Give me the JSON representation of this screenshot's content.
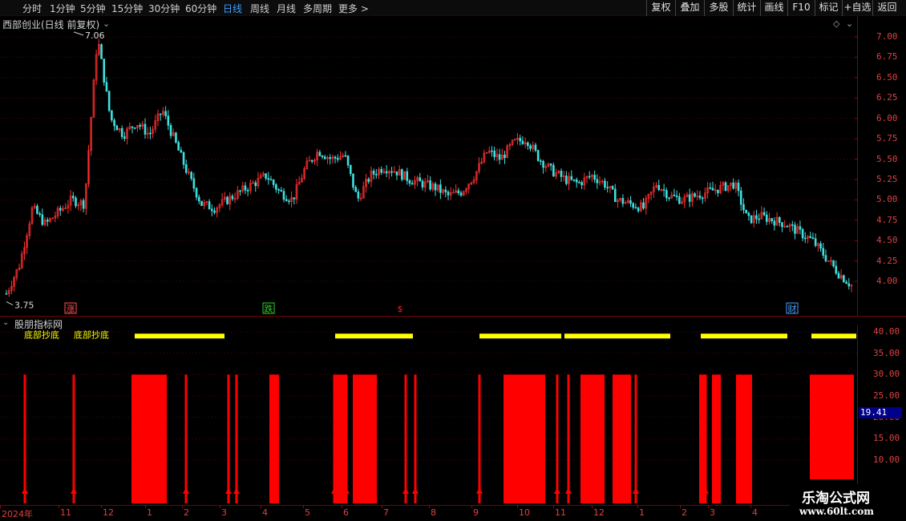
{
  "toolbar": {
    "periods": [
      "分时",
      "1分钟",
      "5分钟",
      "15分钟",
      "30分钟",
      "60分钟",
      "日线",
      "周线",
      "月线",
      "多周期",
      "更多 >"
    ],
    "active_period": "日线",
    "buttons": [
      "复权",
      "叠加",
      "多股",
      "统计",
      "画线",
      "F10",
      "标记",
      "+自选",
      "返回"
    ]
  },
  "main_chart": {
    "title": "西部创业(日线 前复权)",
    "price_axis": [
      "7.00",
      "6.75",
      "6.50",
      "6.25",
      "6.00",
      "5.75",
      "5.50",
      "5.25",
      "5.00",
      "4.75",
      "4.50",
      "4.25",
      "4.00"
    ],
    "high_label": "7.06",
    "low_label": "3.75",
    "markers": [
      {
        "text": "涨",
        "color": "#ff5050"
      },
      {
        "text": "跌",
        "color": "#30d030"
      },
      {
        "text": "$",
        "color": "#ff2020"
      },
      {
        "text": "财",
        "color": "#4aa0ff"
      }
    ]
  },
  "indicator": {
    "title": "股朋指标网",
    "axis": [
      "40.00",
      "35.00",
      "30.00",
      "25.00",
      "20.00",
      "15.00",
      "10.00"
    ],
    "current_value": "19.41",
    "yellow_texts": [
      "底部抄底",
      "底部抄底"
    ]
  },
  "dates": [
    "2024年",
    "11",
    "12",
    "1",
    "2",
    "3",
    "4",
    "5",
    "6",
    "7",
    "8",
    "9",
    "10",
    "11",
    "12",
    "1",
    "2",
    "3",
    "4"
  ],
  "watermark": {
    "title": "乐淘公式网",
    "url": "www.60lt.com"
  },
  "colors": {
    "up": "#ff3030",
    "down": "#40e0e0",
    "grid": "#5a0000",
    "axis_text": "#e04040",
    "bar": "#ff0000",
    "signal_text": "#ffff00"
  },
  "chart_data": {
    "type": "candlestick",
    "symbol": "西部创业",
    "period": "日线 前复权",
    "ylim": [
      3.7,
      7.2
    ],
    "high": 7.06,
    "low": 3.75,
    "series_close_approx": [
      3.85,
      4.2,
      4.9,
      4.7,
      4.85,
      5.0,
      4.95,
      7.0,
      6.0,
      5.8,
      5.95,
      5.8,
      6.1,
      5.7,
      5.3,
      4.95,
      4.9,
      5.0,
      5.1,
      5.2,
      5.3,
      5.1,
      5.0,
      5.4,
      5.6,
      5.5,
      5.55,
      5.0,
      5.3,
      5.4,
      5.35,
      5.25,
      5.2,
      5.15,
      5.05,
      5.1,
      5.3,
      5.6,
      5.5,
      5.7,
      5.75,
      5.5,
      5.35,
      5.25,
      5.2,
      5.3,
      5.2,
      5.0,
      4.95,
      4.9,
      5.2,
      5.05,
      5.0,
      5.05,
      5.1,
      5.15,
      5.2,
      4.75,
      4.8,
      4.75,
      4.7,
      4.6,
      4.5,
      4.3,
      4.1,
      3.95
    ],
    "indicator": {
      "ylim": [
        5,
        42
      ],
      "current_value": 19.41,
      "bar_top_value": 30
    }
  }
}
